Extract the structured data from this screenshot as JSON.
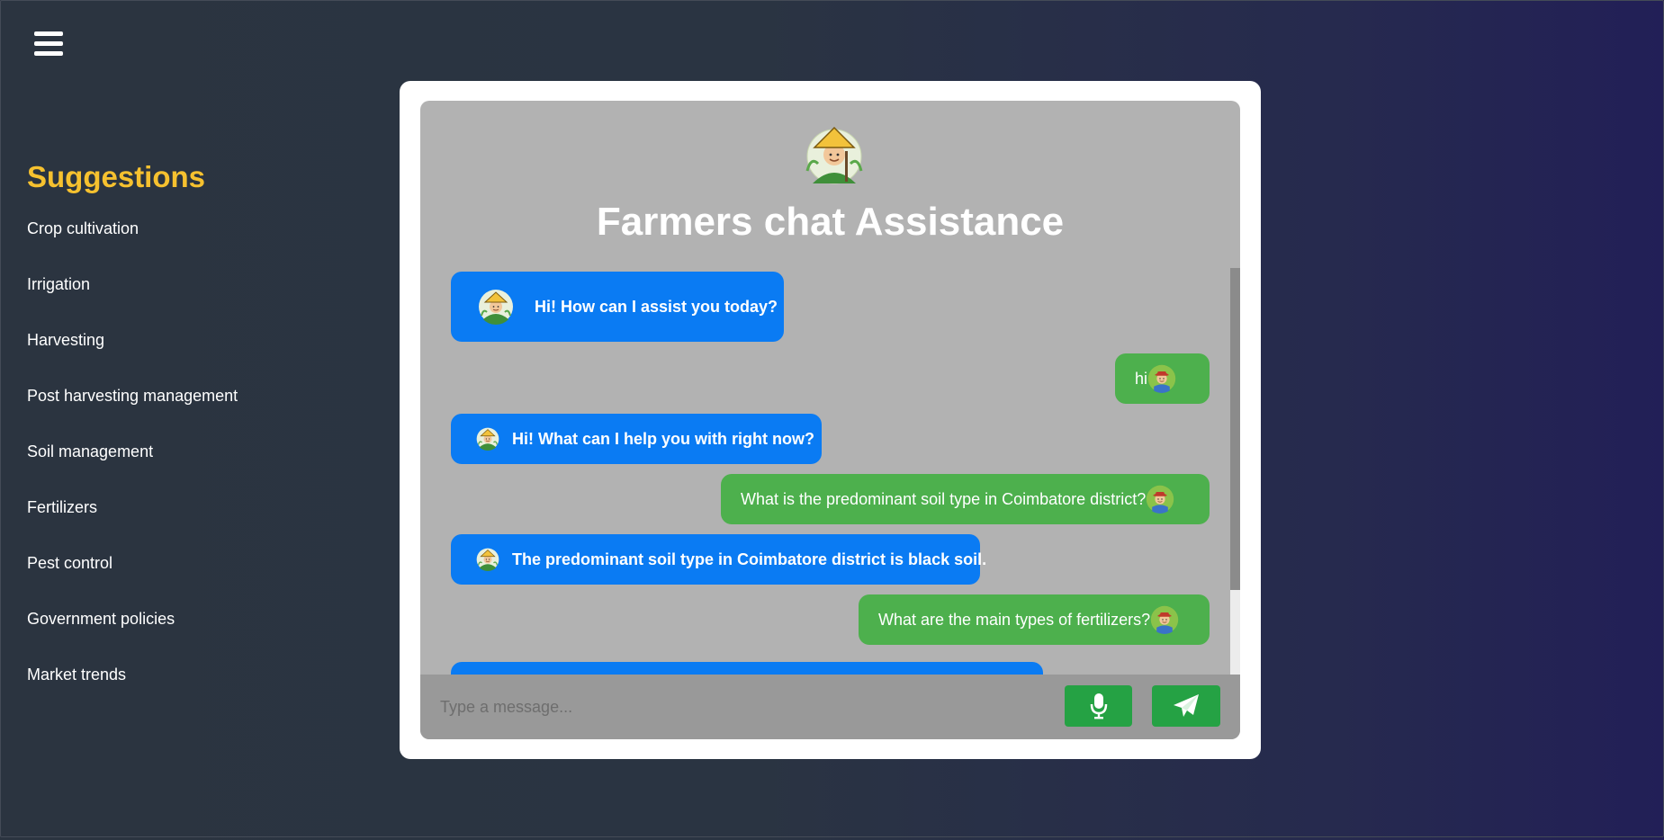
{
  "header": {
    "menu_icon": "hamburger-menu-icon"
  },
  "sidebar": {
    "title": "Suggestions",
    "items": [
      {
        "label": "Crop cultivation"
      },
      {
        "label": "Irrigation"
      },
      {
        "label": "Harvesting"
      },
      {
        "label": "Post harvesting management"
      },
      {
        "label": "Soil management"
      },
      {
        "label": "Fertilizers"
      },
      {
        "label": "Pest control"
      },
      {
        "label": "Government policies"
      },
      {
        "label": "Market trends"
      }
    ]
  },
  "chat": {
    "title": "Farmers chat Assistance",
    "logo": "farmer-logo-icon",
    "messages": [
      {
        "sender": "bot",
        "text": "Hi! How can I assist you today?"
      },
      {
        "sender": "user",
        "text": "hi"
      },
      {
        "sender": "bot",
        "text": "Hi! What can I help you with right now?"
      },
      {
        "sender": "user",
        "text": "What is the predominant soil type in Coimbatore district?"
      },
      {
        "sender": "bot",
        "text": "The predominant soil type in Coimbatore district is black soil."
      },
      {
        "sender": "user",
        "text": "What are the main types of fertilizers?"
      }
    ],
    "input": {
      "placeholder": "Type a message..."
    },
    "mic_icon": "microphone-icon",
    "send_icon": "paper-plane-icon"
  },
  "colors": {
    "accent_yellow": "#f6c12f",
    "bot_bubble": "#0a7bf3",
    "user_bubble": "#4db04d",
    "button_green": "#25a244",
    "chat_bg": "#b2b2b2"
  }
}
